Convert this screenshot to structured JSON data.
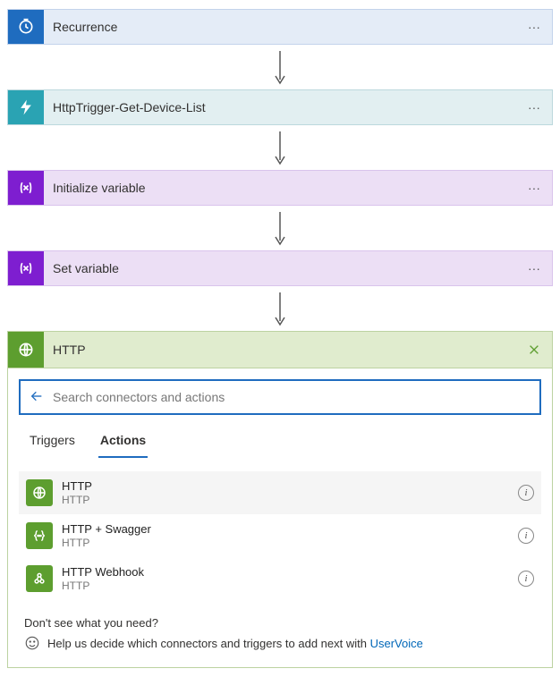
{
  "steps": {
    "recurrence": {
      "title": "Recurrence"
    },
    "httpTrigger": {
      "title": "HttpTrigger-Get-Device-List"
    },
    "initVar": {
      "title": "Initialize variable"
    },
    "setVar": {
      "title": "Set variable"
    }
  },
  "http": {
    "title": "HTTP",
    "search": {
      "placeholder": "Search connectors and actions"
    },
    "tabs": {
      "triggers": "Triggers",
      "actions": "Actions"
    },
    "actions": [
      {
        "name": "HTTP",
        "conn": "HTTP"
      },
      {
        "name": "HTTP + Swagger",
        "conn": "HTTP"
      },
      {
        "name": "HTTP Webhook",
        "conn": "HTTP"
      }
    ],
    "help": {
      "line1": "Don't see what you need?",
      "line2a": "Help us decide which connectors and triggers to add next with ",
      "link": "UserVoice"
    }
  }
}
